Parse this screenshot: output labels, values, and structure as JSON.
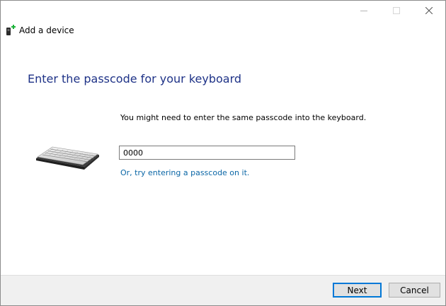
{
  "window": {
    "title": "Add a device",
    "title_icon": "bluetooth-device-add-icon",
    "caption_icons": [
      "minimize-icon",
      "maximize-icon",
      "close-icon"
    ]
  },
  "main": {
    "heading": "Enter the passcode for your keyboard",
    "instruction": "You might need to enter the same passcode into the keyboard.",
    "illustration_icon": "keyboard-icon",
    "passcode": {
      "value": "0000",
      "placeholder": ""
    },
    "alt_link": "Or, try entering a passcode on it."
  },
  "footer": {
    "next_label": "Next",
    "cancel_label": "Cancel"
  },
  "colors": {
    "heading": "#1e3287",
    "link": "#0a66a6",
    "default_button_border": "#0078d7",
    "footer_background": "#f0f0f0"
  }
}
